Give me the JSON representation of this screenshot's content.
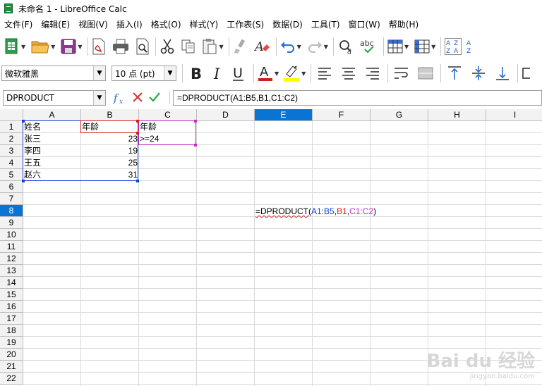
{
  "window": {
    "title": "未命名 1 - LibreOffice Calc"
  },
  "menu": [
    "文件(F)",
    "编辑(E)",
    "视图(V)",
    "插入(I)",
    "格式(O)",
    "样式(Y)",
    "工作表(S)",
    "数据(D)",
    "工具(T)",
    "窗口(W)",
    "帮助(H)"
  ],
  "toolbar2": {
    "font_name": "微软雅黑",
    "font_size": "10 点 (pt)"
  },
  "formula_bar": {
    "name_box": "DPRODUCT",
    "formula": "=DPRODUCT(A1:B5,B1,C1:C2)"
  },
  "columns": [
    "A",
    "B",
    "C",
    "D",
    "E",
    "F",
    "G",
    "H",
    "I"
  ],
  "selected_column": "E",
  "rows": [
    "1",
    "2",
    "3",
    "4",
    "5",
    "6",
    "7",
    "8",
    "9",
    "10",
    "11",
    "12",
    "13",
    "14",
    "15",
    "16",
    "17",
    "18",
    "19",
    "20",
    "21",
    "22"
  ],
  "selected_row": "8",
  "cells": {
    "A1": "姓名",
    "B1": "年龄",
    "C1": "年龄",
    "A2": "张三",
    "B2": "23",
    "C2": ">=24",
    "A3": "李四",
    "B3": "19",
    "A4": "王五",
    "B4": "25",
    "A5": "赵六",
    "B5": "31"
  },
  "edit_formula": {
    "prefix": "=DPRODUCT(",
    "ref1": "A1:B5",
    "comma1": ",",
    "ref2": "B1",
    "comma2": ",",
    "ref3": "C1:C2",
    "suffix": ")"
  },
  "colors": {
    "ref1": "#1a3fd4",
    "ref2": "#d42020",
    "ref3": "#c430c4",
    "selection": "#0a74d4"
  },
  "watermark": {
    "text": "Bai du 经验",
    "sub": "jingyan.baidu.com"
  }
}
